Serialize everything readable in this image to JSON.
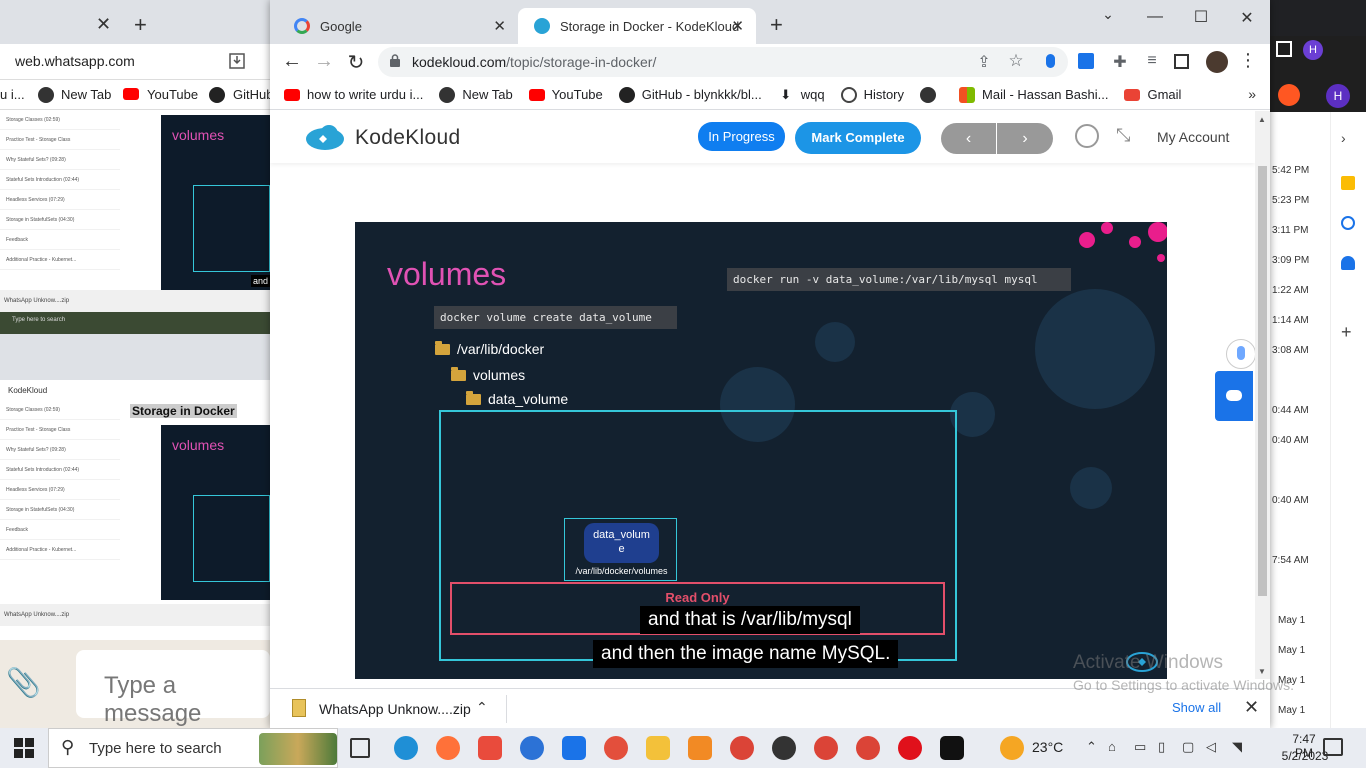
{
  "background_window": {
    "url": "web.whatsapp.com",
    "bookmarks": [
      "u i...",
      "New Tab",
      "YouTube",
      "GitHub"
    ],
    "mini_list_items": [
      "Storage Classes (02:59)",
      "Practice Test - Storage Class",
      "Why Stateful Sets? (09:28)",
      "Stateful Sets Introduction (02:44)",
      "Headless Services (07:29)",
      "Storage in StatefulSets (04:30)",
      "Feedback",
      "Additional Practice - Kubernet..."
    ],
    "mini_slide_title": "volumes",
    "mini_caption": "and",
    "mini_heading": "Storage in Docker",
    "mini_brand": "KodeKloud",
    "mini_download": "WhatsApp Unknow....zip",
    "mini_search": "Type here to search",
    "message_placeholder": "Type a message"
  },
  "right_strip": {
    "times": [
      "5:42 PM",
      "5:23 PM",
      "3:11 PM",
      "3:09 PM",
      "1:22 AM",
      "1:14 AM",
      "3:08 AM",
      "0:44 AM",
      "0:40 AM",
      "0:40 AM",
      "7:54 AM",
      "May 1",
      "May 1",
      "May 1",
      "May 1"
    ]
  },
  "browser": {
    "tabs": [
      {
        "title": "Google",
        "active": false,
        "favicon_color": "#4285f4"
      },
      {
        "title": "Storage in Docker - KodeKloud",
        "active": true,
        "favicon_color": "#29a3d6"
      }
    ],
    "url_host": "kodekloud.com",
    "url_path": "/topic/storage-in-docker/",
    "bookmarks": [
      {
        "label": "how to write urdu i...",
        "icon": "youtube-icon",
        "color": "#ff0000"
      },
      {
        "label": "New Tab",
        "icon": "globe-icon",
        "color": "#333333"
      },
      {
        "label": "YouTube",
        "icon": "youtube-icon",
        "color": "#ff0000"
      },
      {
        "label": "GitHub - blynkkk/bl...",
        "icon": "github-icon",
        "color": "#222222"
      },
      {
        "label": "wqq",
        "icon": "download-icon",
        "color": "#444444"
      },
      {
        "label": "History",
        "icon": "history-icon",
        "color": "#444444"
      },
      {
        "label": "",
        "icon": "globe-icon",
        "color": "#333333"
      },
      {
        "label": "Mail - Hassan Bashi...",
        "icon": "microsoft-icon",
        "color": "#f25022"
      },
      {
        "label": "Gmail",
        "icon": "gmail-icon",
        "color": "#ea4335"
      }
    ]
  },
  "kodekloud": {
    "brand": "KodeKloud",
    "in_progress_label": "In Progress",
    "mark_complete_label": "Mark Complete",
    "prev_label": "‹",
    "next_label": "›",
    "account_label": "My Account"
  },
  "slide": {
    "title": "volumes",
    "run_command": "docker run -v data_volume:/var/lib/mysql mysql",
    "create_command": "docker volume create data_volume",
    "folders": [
      "/var/lib/docker",
      "volumes",
      "data_volume"
    ],
    "container_label_1": "data_volum",
    "container_label_2": "e",
    "container_path": "/var/lib/docker/volumes",
    "read_only_label": "Read Only",
    "caption_line_1": "and that is /var/lib/mysql",
    "caption_line_2": "and then the image name MySQL."
  },
  "downloads": {
    "file_name": "WhatsApp Unknow....zip",
    "show_all_label": "Show all"
  },
  "activation": {
    "title": "Activate Windows",
    "subtitle": "Go to Settings to activate Windows."
  },
  "taskbar": {
    "search_placeholder": "Type here to search",
    "temperature": "23°C",
    "time": "7:47 PM",
    "date": "5/2/2023"
  },
  "colors": {
    "accent_blue": "#1c95e6",
    "slide_bg": "#13212f",
    "title_pink": "#e052b4",
    "box_cyan": "#35c7d9",
    "read_only_red": "#e34f6a"
  }
}
